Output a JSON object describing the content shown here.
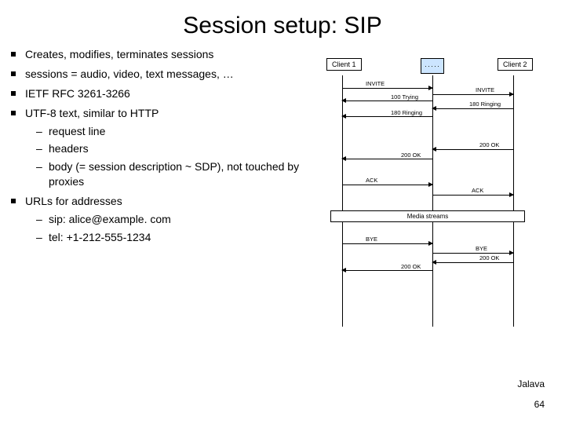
{
  "title": "Session setup: SIP",
  "bullets": {
    "b1": "Creates, modifies, terminates sessions",
    "b2": "sessions = audio, video, text messages, …",
    "b3": "IETF RFC 3261-3266",
    "b4": "UTF-8 text, similar to HTTP",
    "b4_subs": {
      "s1": "request line",
      "s2": "headers",
      "s3": "body (= session description ~ SDP), not touched by proxies"
    },
    "b5": "URLs for addresses",
    "b5_subs": {
      "s1": "sip: alice@example. com",
      "s2": "tel: +1-212-555-1234"
    }
  },
  "diagram": {
    "client1": "Client 1",
    "client2": "Client 2",
    "proxy": "·····",
    "messages": {
      "invite1": "INVITE",
      "invite2": "INVITE",
      "trying": "100 Trying",
      "ringing1": "180 Ringing",
      "ringing2": "180 Ringing",
      "ok1": "200 OK",
      "ok2": "200 OK",
      "ack1": "ACK",
      "ack2": "ACK",
      "media": "Media streams",
      "bye1": "BYE",
      "bye2": "BYE",
      "ok3": "200 OK",
      "ok4": "200 OK"
    }
  },
  "footer": {
    "author": "Jalava",
    "page": "64"
  }
}
